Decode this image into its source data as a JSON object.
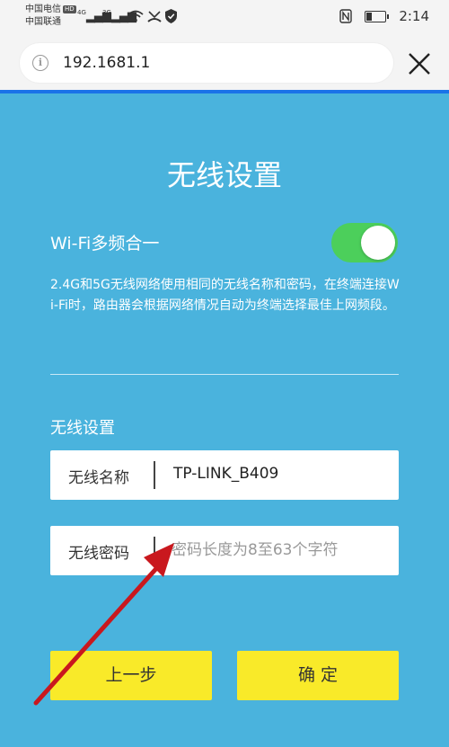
{
  "status_bar": {
    "carrier1": "中国电信",
    "carrier1_badge": "HD",
    "carrier2": "中国联通",
    "signal1_label": "4G",
    "signal2_label": "3G",
    "time": "2:14"
  },
  "browser": {
    "url": "192.1681.1"
  },
  "page": {
    "title": "无线设置",
    "wifi_merge_label": "Wi-Fi多频合一",
    "wifi_merge_enabled": true,
    "description": "2.4G和5G无线网络使用相同的无线名称和密码，在终端连接Wi-Fi时，路由器会根据网络情况自动为终端选择最佳上网频段。",
    "section_title": "无线设置",
    "ssid_label": "无线名称",
    "ssid_value": "TP-LINK_B409",
    "password_label": "无线密码",
    "password_placeholder": "密码长度为8至63个字符",
    "back_button": "上一步",
    "confirm_button": "确 定"
  },
  "colors": {
    "background": "#4ab3dd",
    "toggle_on": "#4ccf5b",
    "button": "#f9ea29",
    "annotation_arrow": "#c9181e"
  }
}
